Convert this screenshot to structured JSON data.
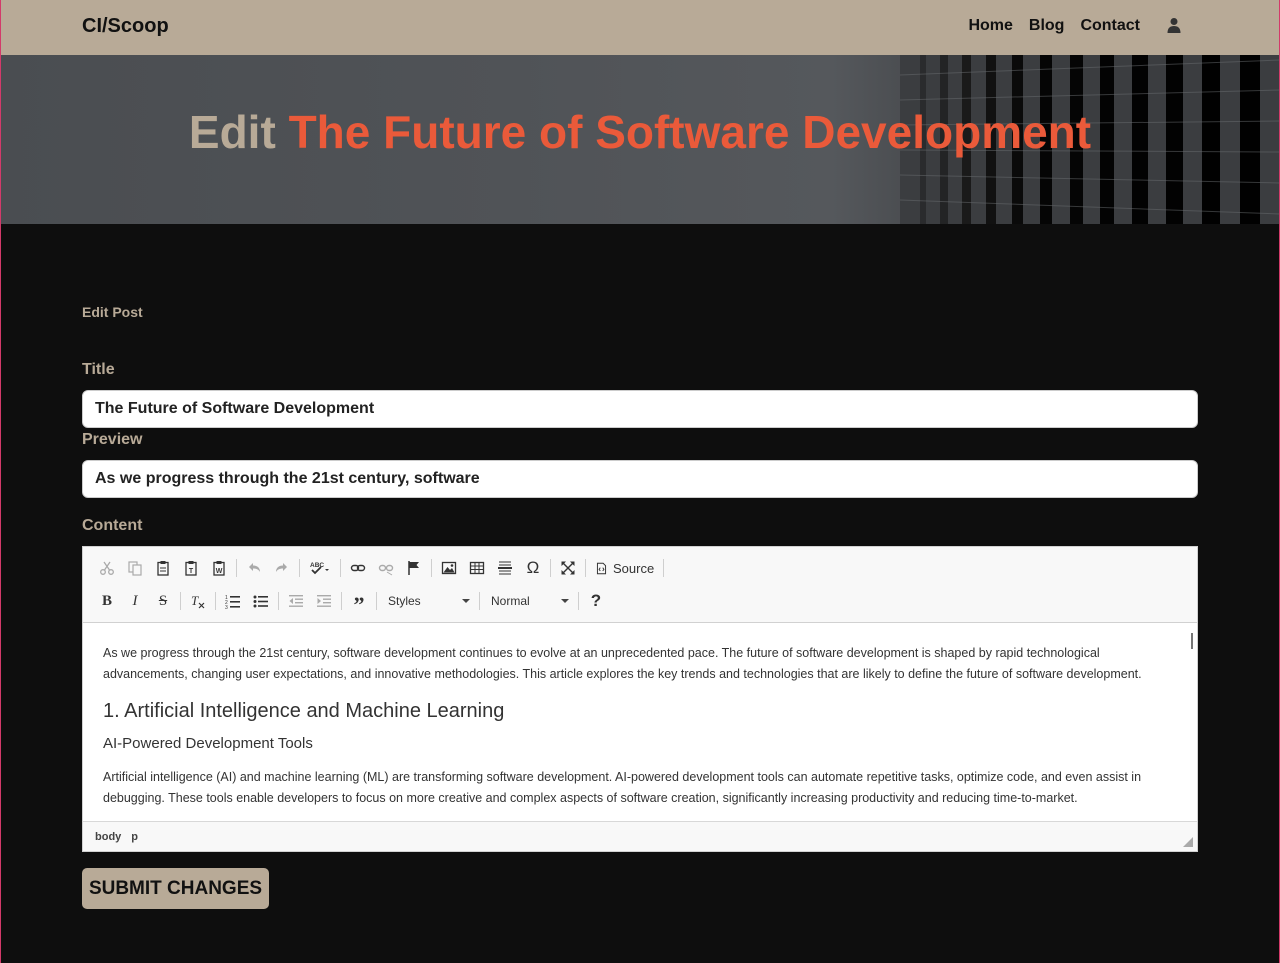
{
  "navbar": {
    "brand": "CI/Scoop",
    "links": [
      "Home",
      "Blog",
      "Contact"
    ],
    "account_icon": "user-icon"
  },
  "hero": {
    "edit_word": "Edit",
    "post_title": "The Future of Software Development"
  },
  "form": {
    "section_label": "Edit Post",
    "title_label": "Title",
    "title_value": "The Future of Software Development",
    "preview_label": "Preview",
    "preview_value": "As we progress through the 21st century, software",
    "content_label": "Content",
    "submit_label": "SUBMIT CHANGES"
  },
  "editor": {
    "source_label": "Source",
    "styles_label": "Styles",
    "format_label": "Normal",
    "help_label": "?",
    "path": [
      "body",
      "p"
    ],
    "content": {
      "intro": "As we progress through the 21st century, software development continues to evolve at an unprecedented pace. The future of software development is shaped by rapid technological advancements, changing user expectations, and innovative methodologies. This article explores the key trends and technologies that are likely to define the future of software development.",
      "h2": "1. Artificial Intelligence and Machine Learning",
      "h3": "AI-Powered Development Tools",
      "p2": "Artificial intelligence (AI) and machine learning (ML) are transforming software development. AI-powered development tools can automate repetitive tasks, optimize code, and even assist in debugging. These tools enable developers to focus on more creative and complex aspects of software creation, significantly increasing productivity and reducing time-to-market."
    },
    "toolbar_icons": [
      "cut-icon",
      "copy-icon",
      "paste-icon",
      "paste-text-icon",
      "paste-word-icon",
      "undo-icon",
      "redo-icon",
      "spellcheck-icon",
      "link-icon",
      "unlink-icon",
      "anchor-icon",
      "image-icon",
      "table-icon",
      "horizontal-rule-icon",
      "special-char-icon",
      "maximize-icon",
      "source-icon",
      "bold-icon",
      "italic-icon",
      "strike-icon",
      "remove-format-icon",
      "numbered-list-icon",
      "bulleted-list-icon",
      "outdent-icon",
      "indent-icon",
      "blockquote-icon"
    ]
  },
  "colors": {
    "accent": "#b8aa97",
    "title_highlight": "#ea5a3a",
    "background": "#0e0e0e"
  }
}
